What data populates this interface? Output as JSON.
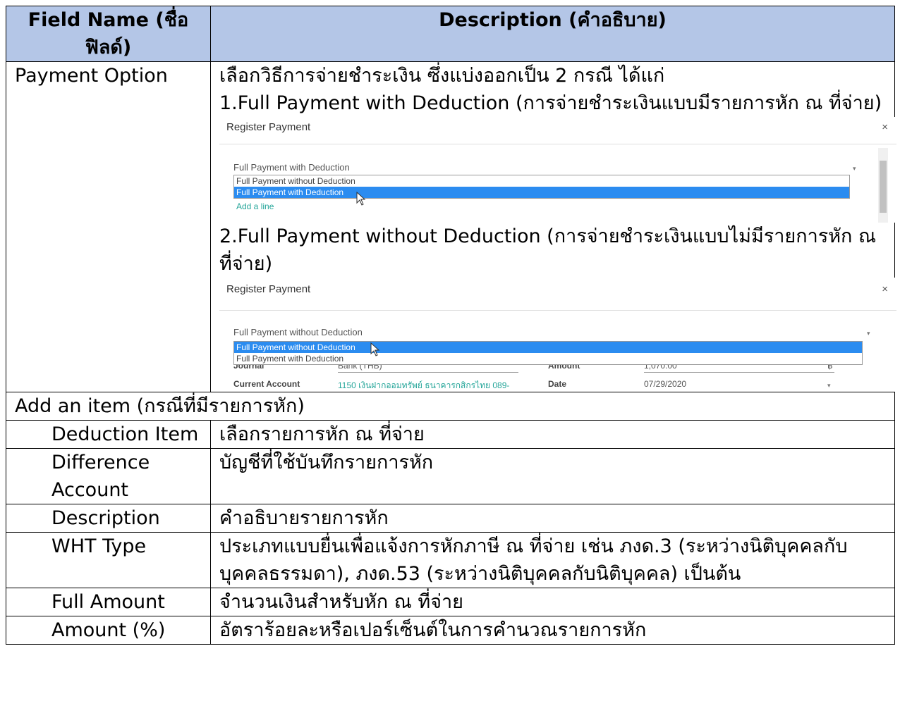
{
  "table": {
    "header": {
      "field_name": "Field Name (ชื่อฟิลด์)",
      "description": "Description (คำอธิบาย)"
    },
    "payment_option": {
      "name": "Payment Option",
      "intro": "เลือกวิธีการจ่ายชำระเงิน ซึ่งแบ่งออกเป็น 2 กรณี ได้แก่",
      "option1": "1.Full Payment with Deduction (การจ่ายชำระเงินแบบมีรายการหัก ณ ที่จ่าย)",
      "option2": "2.Full Payment without Deduction (การจ่ายชำระเงินแบบไม่มีรายการหัก ณ ที่จ่าย)"
    },
    "section_add_item": "Add an item (กรณีที่มีรายการหัก)",
    "rows": [
      {
        "name": "Deduction Item",
        "desc": "เลือกรายการหัก ณ ที่จ่าย"
      },
      {
        "name": "Difference Account",
        "desc": "บัญชีที่ใช้บันทึกรายการหัก"
      },
      {
        "name": "Description",
        "desc": "คำอธิบายรายการหัก"
      },
      {
        "name": "WHT Type",
        "desc": "ประเภทแบบยื่นเพื่อแจ้งการหักภาษี ณ ที่จ่าย เช่น ภงด.3 (ระหว่างนิติบุคคลกับบุคคลธรรมดา), ภงด.53 (ระหว่างนิติบุคคลกับนิติบุคคล) เป็นต้น"
      },
      {
        "name": "Full Amount",
        "desc": "จำนวนเงินสำหรับหัก ณ ที่จ่าย"
      },
      {
        "name": "Amount (%)",
        "desc": "อัตราร้อยละหรือเปอร์เซ็นต์ในการคำนวณรายการหัก"
      }
    ]
  },
  "screenshot1": {
    "title": "Register Payment",
    "close": "×",
    "field_value": "Full Payment with Deduction",
    "options": [
      "Full Payment without Deduction",
      "Full Payment with Deduction"
    ],
    "selected_index": 1,
    "add_line": "Add a line"
  },
  "screenshot2": {
    "title": "Register Payment",
    "close": "×",
    "field_value": "Full Payment without Deduction",
    "options": [
      "Full Payment without Deduction",
      "Full Payment with Deduction"
    ],
    "selected_index": 0,
    "journal_label": "Journal",
    "journal_value": "Bank (THB)",
    "amount_label": "Amount",
    "amount_value": "1,070.00",
    "currency": "฿",
    "current_account_label": "Current Account",
    "current_account_value": "1150 เงินฝากออมทรัพย์ ธนาคารกสิกรไทย 089-",
    "date_label": "Date",
    "date_value": "07/29/2020"
  },
  "colors": {
    "header_bg": "#b4c6e7",
    "selected_option": "#2b8cf0",
    "link_teal": "#26a69a"
  }
}
